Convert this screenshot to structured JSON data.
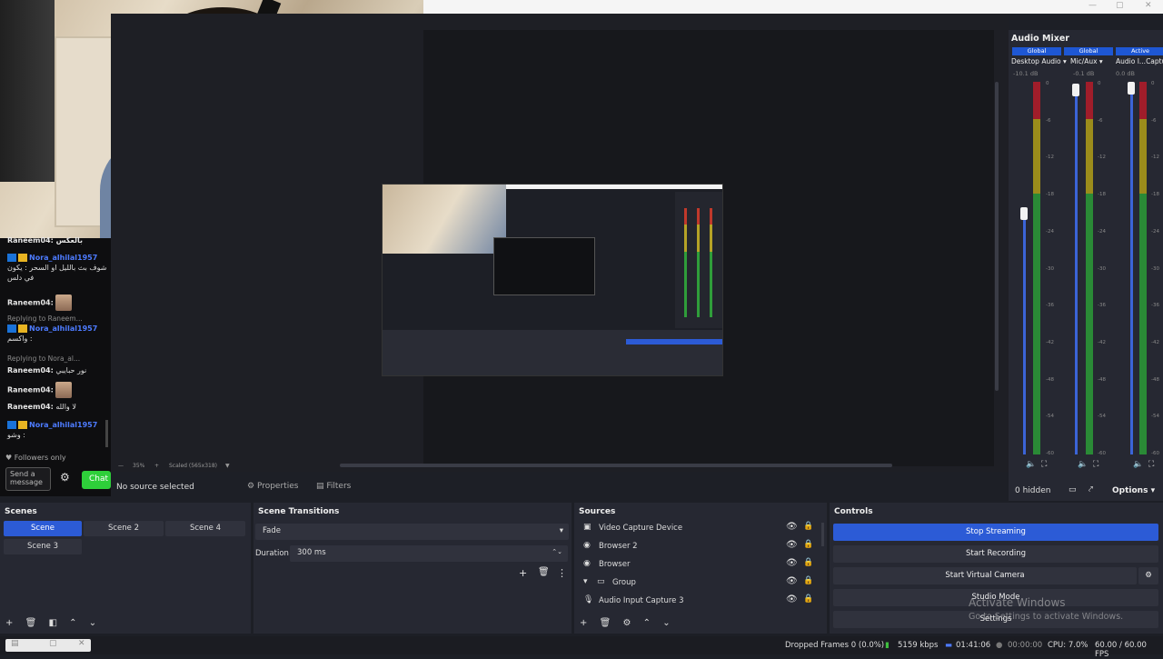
{
  "chat": {
    "lines": [
      {
        "name": "Nora_alhilal1957",
        "text": "شوف بث بالليل او السحر : يكون في دلس"
      },
      {
        "name": "Raneem04:",
        "reply": "Replying to Raneem..."
      },
      {
        "name": "Nora_alhilal1957",
        "text": "واكسم :"
      },
      {
        "reply2": "Replying to Nora_al..."
      },
      {
        "name": "Raneem04:",
        "text": "نور حبايبي"
      },
      {
        "name": "Raneem04:"
      },
      {
        "name": "Raneem04:",
        "text": "لا والله"
      },
      {
        "name": "Nora_alhilal1957",
        "text": "وشو :"
      }
    ],
    "top_fragment": "Raneem04: بالعكس",
    "followers_only": "Followers only",
    "input_placeholder": "Send a message",
    "chat_button": "Chat"
  },
  "preview": {
    "zoom": "35%",
    "scaled": "Scaled (565x318)"
  },
  "source_bar": {
    "no_source": "No source selected",
    "properties": "Properties",
    "filters": "Filters"
  },
  "mixer": {
    "title": "Audio Mixer",
    "channels": [
      {
        "global": "Global",
        "name": "Desktop Audio",
        "db": "-10.1 dB"
      },
      {
        "global": "Global",
        "name": "Mic/Aux",
        "db": "-0.1 dB"
      },
      {
        "global": "Active",
        "name": "Audio I...Captu",
        "db": "0.0 dB"
      }
    ],
    "ticks": [
      "0",
      "-6",
      "-12",
      "-18",
      "-24",
      "-30",
      "-36",
      "-42",
      "-48",
      "-54",
      "-60"
    ],
    "hidden": "0 hidden",
    "options": "Options"
  },
  "scenes": {
    "title": "Scenes",
    "items": [
      "Scene",
      "Scene 2",
      "Scene 4",
      "Scene 3"
    ]
  },
  "transitions": {
    "title": "Scene Transitions",
    "type": "Fade",
    "duration_label": "Duration",
    "duration_value": "300 ms"
  },
  "sources": {
    "title": "Sources",
    "items": [
      "Video Capture Device",
      "Browser 2",
      "Browser",
      "Group",
      "Audio Input Capture 3"
    ]
  },
  "controls": {
    "title": "Controls",
    "stop_streaming": "Stop Streaming",
    "start_recording": "Start Recording",
    "start_virtual_camera": "Start Virtual Camera",
    "studio_mode": "Studio Mode",
    "settings": "Settings"
  },
  "watermark": {
    "line1": "Activate Windows",
    "line2": "Go to Settings to activate Windows."
  },
  "status": {
    "dropped": "Dropped Frames 0 (0.0%)",
    "kbps": "5159 kbps",
    "stream_time": "01:41:06",
    "rec_time": "00:00:00",
    "cpu": "CPU: 7.0%",
    "fps": "60.00 / 60.00 FPS"
  },
  "colors": {
    "accent": "#2c5bd6",
    "chat_name": "#4d7bff",
    "chat_button": "#2ecf3a"
  }
}
